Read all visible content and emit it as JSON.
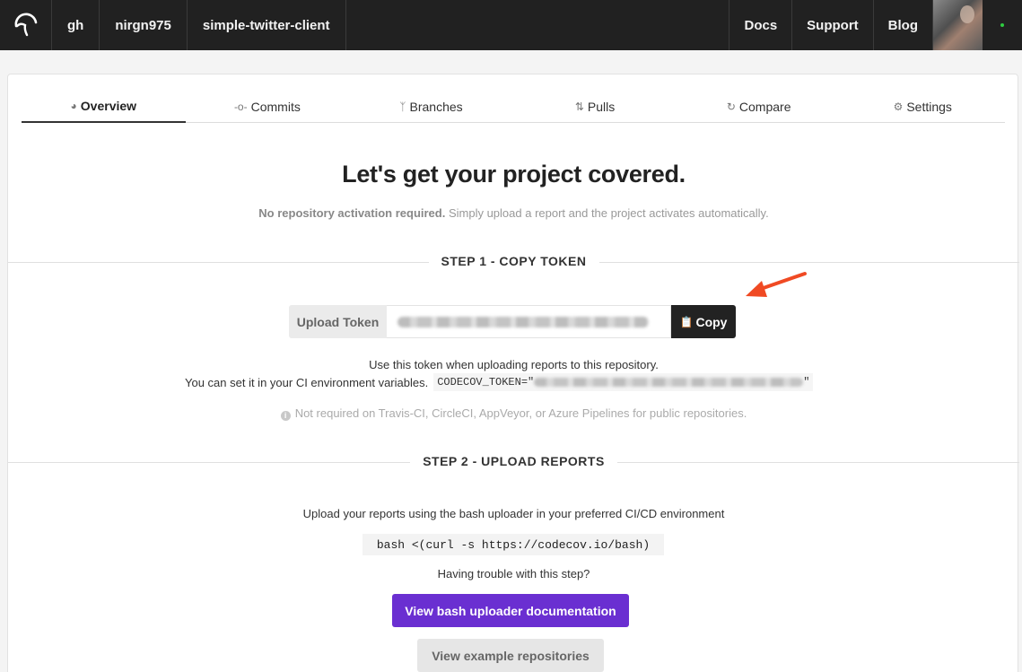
{
  "nav": {
    "crumbs": [
      "gh",
      "nirgn975",
      "simple-twitter-client"
    ],
    "links": [
      "Docs",
      "Support",
      "Blog"
    ]
  },
  "tabs": [
    {
      "label": "Overview",
      "icon": "dashboard-icon",
      "active": true
    },
    {
      "label": "Commits",
      "icon": "commit-icon"
    },
    {
      "label": "Branches",
      "icon": "branch-icon"
    },
    {
      "label": "Pulls",
      "icon": "pull-request-icon"
    },
    {
      "label": "Compare",
      "icon": "compare-icon"
    },
    {
      "label": "Settings",
      "icon": "gears-icon"
    }
  ],
  "main": {
    "headline": "Let's get your project covered.",
    "sub_bold": "No repository activation required.",
    "sub_rest": " Simply upload a report and the project activates automatically."
  },
  "step1": {
    "title": "STEP 1 - COPY TOKEN",
    "token_label": "Upload Token",
    "copy_label": "Copy",
    "info_line1": "Use this token when uploading reports to this repository.",
    "info_line2": "You can set it in your CI environment variables.",
    "env_prefix": "CODECOV_TOKEN=\"",
    "env_suffix": "\"",
    "note": "Not required on Travis-CI, CircleCI, AppVeyor, or Azure Pipelines for public repositories."
  },
  "step2": {
    "title": "STEP 2 - UPLOAD REPORTS",
    "description": "Upload your reports using the bash uploader in your preferred CI/CD environment",
    "command": "bash <(curl -s https://codecov.io/bash)",
    "trouble": "Having trouble with this step?",
    "docs_button": "View bash uploader documentation",
    "examples_button": "View example repositories"
  },
  "colors": {
    "topbar": "#212121",
    "accent_purple": "#6a2fd1",
    "annotation_arrow": "#f04a23"
  }
}
